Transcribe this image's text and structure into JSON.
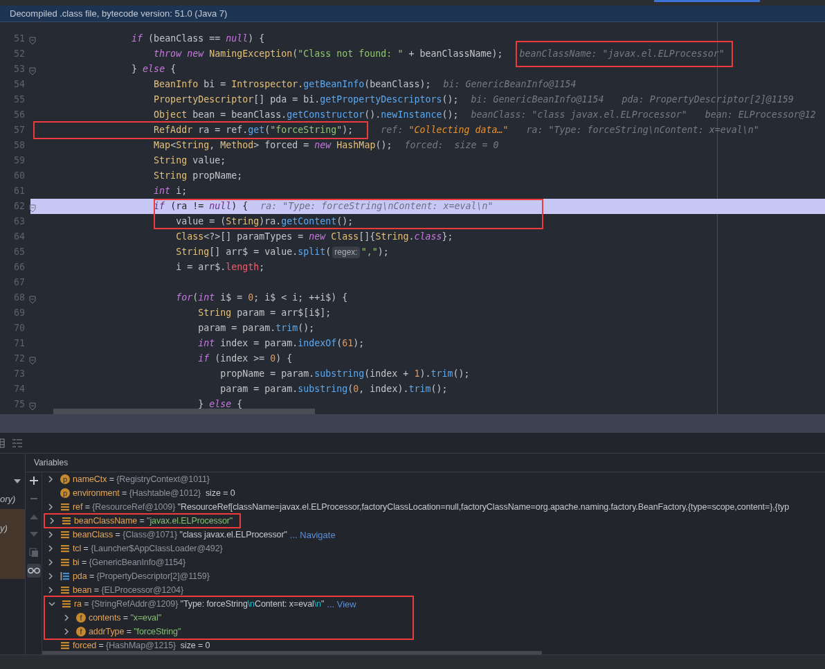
{
  "banner": "Decompiled .class file, bytecode version: 51.0 (Java 7)",
  "editor": {
    "lines": [
      {
        "number": "51",
        "fold": true,
        "current": false,
        "code": [
          {
            "text": "                if",
            "kind": "keyword"
          },
          {
            "text": " (beanClass == ",
            "kind": "plain"
          },
          {
            "text": "null",
            "kind": "keyword"
          },
          {
            "text": ") {",
            "kind": "plain"
          }
        ]
      },
      {
        "number": "52",
        "fold": false,
        "current": false,
        "box_hints": true,
        "code": [
          {
            "text": "                    throw",
            "kind": "keyword"
          },
          {
            "text": " new",
            "kind": "keyword"
          },
          {
            "text": " NamingException",
            "kind": "type"
          },
          {
            "text": "(",
            "kind": "plain"
          },
          {
            "text": "\"Class not found: \"",
            "kind": "string"
          },
          {
            "text": " + beanClassName);",
            "kind": "plain"
          }
        ],
        "hints": [
          {
            "label": "beanClassName:",
            "value": "\"javax.el.ELProcessor\"",
            "kind": "value"
          }
        ]
      },
      {
        "number": "53",
        "fold": true,
        "current": false,
        "code": [
          {
            "text": "                } ",
            "kind": "plain"
          },
          {
            "text": "else",
            "kind": "keyword"
          },
          {
            "text": " {",
            "kind": "plain"
          }
        ]
      },
      {
        "number": "54",
        "fold": false,
        "current": false,
        "code": [
          {
            "text": "                    BeanInfo",
            "kind": "type"
          },
          {
            "text": " bi = ",
            "kind": "plain"
          },
          {
            "text": "Introspector.",
            "kind": "type"
          },
          {
            "text": "getBeanInfo",
            "kind": "method"
          },
          {
            "text": "(beanClass);",
            "kind": "plain"
          }
        ],
        "hints": [
          {
            "label": "bi:",
            "value": "GenericBeanInfo@1154",
            "kind": "value"
          }
        ]
      },
      {
        "number": "55",
        "fold": false,
        "current": false,
        "code": [
          {
            "text": "                    PropertyDescriptor",
            "kind": "type"
          },
          {
            "text": "[] pda = bi.",
            "kind": "plain"
          },
          {
            "text": "getPropertyDescriptors",
            "kind": "method"
          },
          {
            "text": "();",
            "kind": "plain"
          }
        ],
        "hints": [
          {
            "label": "bi:",
            "value": "GenericBeanInfo@1154",
            "kind": "value"
          },
          {
            "label": "pda:",
            "value": "PropertyDescriptor[2]@1159",
            "kind": "value"
          }
        ]
      },
      {
        "number": "56",
        "fold": false,
        "current": false,
        "code": [
          {
            "text": "                    Object",
            "kind": "type"
          },
          {
            "text": " bean = beanClass.",
            "kind": "plain"
          },
          {
            "text": "getConstructor",
            "kind": "method"
          },
          {
            "text": "().",
            "kind": "plain"
          },
          {
            "text": "newInstance",
            "kind": "method"
          },
          {
            "text": "();",
            "kind": "plain"
          }
        ],
        "hints": [
          {
            "label": "beanClass:",
            "value": "\"class javax.el.ELProcessor\"",
            "kind": "value"
          },
          {
            "label": "bean:",
            "value": "ELProcessor@12",
            "kind": "value"
          }
        ]
      },
      {
        "number": "57",
        "fold": false,
        "current": false,
        "box_code": true,
        "code": [
          {
            "text": "                    RefAddr",
            "kind": "type"
          },
          {
            "text": " ra = ref.",
            "kind": "plain"
          },
          {
            "text": "get",
            "kind": "method"
          },
          {
            "text": "(",
            "kind": "plain"
          },
          {
            "text": "\"forceString\"",
            "kind": "string"
          },
          {
            "text": ");",
            "kind": "plain"
          }
        ],
        "hints": [
          {
            "label": "ref:",
            "value": "\"Collecting data…\"",
            "kind": "loading"
          },
          {
            "label": "ra:",
            "value": "\"Type: forceString\\nContent: x=eval\\n\"",
            "kind": "value"
          }
        ]
      },
      {
        "number": "58",
        "fold": false,
        "current": false,
        "code": [
          {
            "text": "                    Map",
            "kind": "type"
          },
          {
            "text": "<",
            "kind": "plain"
          },
          {
            "text": "String",
            "kind": "type"
          },
          {
            "text": ", ",
            "kind": "plain"
          },
          {
            "text": "Method",
            "kind": "type"
          },
          {
            "text": "> forced = ",
            "kind": "plain"
          },
          {
            "text": "new",
            "kind": "keyword"
          },
          {
            "text": " HashMap",
            "kind": "type"
          },
          {
            "text": "();",
            "kind": "plain"
          }
        ],
        "hints": [
          {
            "label": "forced:",
            "value": " size = 0",
            "kind": "value"
          }
        ]
      },
      {
        "number": "59",
        "fold": false,
        "current": false,
        "code": [
          {
            "text": "                    String",
            "kind": "type"
          },
          {
            "text": " value;",
            "kind": "plain"
          }
        ]
      },
      {
        "number": "60",
        "fold": false,
        "current": false,
        "code": [
          {
            "text": "                    String",
            "kind": "type"
          },
          {
            "text": " propName;",
            "kind": "plain"
          }
        ]
      },
      {
        "number": "61",
        "fold": false,
        "current": false,
        "code": [
          {
            "text": "                    int",
            "kind": "keyword"
          },
          {
            "text": " i;",
            "kind": "plain"
          }
        ]
      },
      {
        "number": "62",
        "fold": true,
        "current": true,
        "box_lines": true,
        "code": [
          {
            "text": "                    if",
            "kind": "keyword"
          },
          {
            "text": " (ra != ",
            "kind": "plain"
          },
          {
            "text": "null",
            "kind": "keyword"
          },
          {
            "text": ") {",
            "kind": "plain"
          }
        ],
        "hints": [
          {
            "label": "ra:",
            "value": "\"Type: forceString\\nContent: x=eval\\n\"",
            "kind": "value"
          }
        ]
      },
      {
        "number": "63",
        "fold": false,
        "current": false,
        "box_lines": true,
        "code": [
          {
            "text": "                        value = (",
            "kind": "plain"
          },
          {
            "text": "String",
            "kind": "type"
          },
          {
            "text": ")ra.",
            "kind": "plain"
          },
          {
            "text": "getContent",
            "kind": "method"
          },
          {
            "text": "();",
            "kind": "plain"
          }
        ]
      },
      {
        "number": "64",
        "fold": false,
        "current": false,
        "code": [
          {
            "text": "                        Class",
            "kind": "type"
          },
          {
            "text": "<?>[] paramTypes = ",
            "kind": "plain"
          },
          {
            "text": "new",
            "kind": "keyword"
          },
          {
            "text": " Class",
            "kind": "type"
          },
          {
            "text": "[]{",
            "kind": "plain"
          },
          {
            "text": "String",
            "kind": "type"
          },
          {
            "text": ".",
            "kind": "plain"
          },
          {
            "text": "class",
            "kind": "keyword"
          },
          {
            "text": "};",
            "kind": "plain"
          }
        ]
      },
      {
        "number": "65",
        "fold": false,
        "current": false,
        "code": [
          {
            "text": "                        String",
            "kind": "type"
          },
          {
            "text": "[] arr$ = value.",
            "kind": "plain"
          },
          {
            "text": "split",
            "kind": "method"
          },
          {
            "text": "(",
            "kind": "plain"
          },
          {
            "text": "regex:",
            "kind": "chip"
          },
          {
            "text": "\",\"",
            "kind": "string"
          },
          {
            "text": ");",
            "kind": "plain"
          }
        ]
      },
      {
        "number": "66",
        "fold": false,
        "current": false,
        "code": [
          {
            "text": "                        i = arr$.",
            "kind": "plain"
          },
          {
            "text": "length",
            "kind": "field"
          },
          {
            "text": ";",
            "kind": "plain"
          }
        ]
      },
      {
        "number": "67",
        "fold": false,
        "current": false
      },
      {
        "number": "68",
        "fold": true,
        "current": false,
        "code": [
          {
            "text": "                        for",
            "kind": "keyword"
          },
          {
            "text": "(",
            "kind": "plain"
          },
          {
            "text": "int",
            "kind": "keyword"
          },
          {
            "text": " i$ = ",
            "kind": "plain"
          },
          {
            "text": "0",
            "kind": "number"
          },
          {
            "text": "; i$ < i; ++i$) {",
            "kind": "plain"
          }
        ]
      },
      {
        "number": "69",
        "fold": false,
        "current": false,
        "code": [
          {
            "text": "                            String",
            "kind": "type"
          },
          {
            "text": " param = arr$[i$];",
            "kind": "plain"
          }
        ]
      },
      {
        "number": "70",
        "fold": false,
        "current": false,
        "code": [
          {
            "text": "                            param = param.",
            "kind": "plain"
          },
          {
            "text": "trim",
            "kind": "method"
          },
          {
            "text": "();",
            "kind": "plain"
          }
        ]
      },
      {
        "number": "71",
        "fold": false,
        "current": false,
        "code": [
          {
            "text": "                            int",
            "kind": "keyword"
          },
          {
            "text": " index = param.",
            "kind": "plain"
          },
          {
            "text": "indexOf",
            "kind": "method"
          },
          {
            "text": "(",
            "kind": "plain"
          },
          {
            "text": "61",
            "kind": "number"
          },
          {
            "text": ");",
            "kind": "plain"
          }
        ]
      },
      {
        "number": "72",
        "fold": true,
        "current": false,
        "code": [
          {
            "text": "                            if",
            "kind": "keyword"
          },
          {
            "text": " (index >= ",
            "kind": "plain"
          },
          {
            "text": "0",
            "kind": "number"
          },
          {
            "text": ") {",
            "kind": "plain"
          }
        ]
      },
      {
        "number": "73",
        "fold": false,
        "current": false,
        "code": [
          {
            "text": "                                propName = param.",
            "kind": "plain"
          },
          {
            "text": "substring",
            "kind": "method"
          },
          {
            "text": "(index + ",
            "kind": "plain"
          },
          {
            "text": "1",
            "kind": "number"
          },
          {
            "text": ").",
            "kind": "plain"
          },
          {
            "text": "trim",
            "kind": "method"
          },
          {
            "text": "();",
            "kind": "plain"
          }
        ]
      },
      {
        "number": "74",
        "fold": false,
        "current": false,
        "code": [
          {
            "text": "                                param = param.",
            "kind": "plain"
          },
          {
            "text": "substring",
            "kind": "method"
          },
          {
            "text": "(",
            "kind": "plain"
          },
          {
            "text": "0",
            "kind": "number"
          },
          {
            "text": ", index).",
            "kind": "plain"
          },
          {
            "text": "trim",
            "kind": "method"
          },
          {
            "text": "();",
            "kind": "plain"
          }
        ]
      },
      {
        "number": "75",
        "fold": true,
        "current": false,
        "code": [
          {
            "text": "                            } ",
            "kind": "plain"
          },
          {
            "text": "else",
            "kind": "keyword"
          },
          {
            "text": " {",
            "kind": "plain"
          }
        ]
      }
    ]
  },
  "debugger": {
    "frames": [
      {
        "text": "ory)",
        "selected": false
      },
      {
        "text": "y)",
        "selected": true
      }
    ],
    "variables_title": "Variables",
    "variables": [
      {
        "name": "nameCtx",
        "op": "=",
        "kind": "param",
        "badge": "p",
        "expandable": true,
        "expanded": false,
        "type": "{RegistryContext@1011}"
      },
      {
        "name": "environment",
        "op": "=",
        "kind": "param",
        "badge": "p",
        "expandable": false,
        "type": "{Hashtable@1012}",
        "extra": "size = 0"
      },
      {
        "name": "ref",
        "op": "=",
        "kind": "local",
        "expandable": true,
        "expanded": false,
        "type": "{ResourceRef@1009}",
        "value": [
          {
            "text": "\"ResourceRef[className=javax.el.ELProcessor,factoryClassLocation=null,factoryClassName=org.apache.naming.factory.BeanFactory,{type=scope,content=},{typ",
            "kind": "plain"
          }
        ]
      },
      {
        "name": "beanClassName",
        "op": "=",
        "kind": "local",
        "expandable": true,
        "expanded": false,
        "marked": true,
        "value": [
          {
            "text": "\"javax.el.ELProcessor\"",
            "kind": "string"
          }
        ]
      },
      {
        "name": "beanClass",
        "op": "=",
        "kind": "local",
        "expandable": true,
        "expanded": false,
        "type": "{Class@1071}",
        "value": [
          {
            "text": "\"class javax.el.ELProcessor\"",
            "kind": "plain"
          }
        ],
        "link": "... Navigate"
      },
      {
        "name": "tcl",
        "op": "=",
        "kind": "local",
        "expandable": true,
        "expanded": false,
        "type": "{Launcher$AppClassLoader@492}"
      },
      {
        "name": "bi",
        "op": "=",
        "kind": "local",
        "expandable": true,
        "expanded": false,
        "type": "{GenericBeanInfo@1154}"
      },
      {
        "name": "pda",
        "op": "=",
        "kind": "array",
        "expandable": true,
        "expanded": false,
        "type": "{PropertyDescriptor[2]@1159}"
      },
      {
        "name": "bean",
        "op": "=",
        "kind": "local",
        "expandable": true,
        "expanded": false,
        "type": "{ELProcessor@1204}"
      },
      {
        "name": "ra",
        "op": "=",
        "kind": "local",
        "expandable": true,
        "expanded": true,
        "marked": true,
        "type": "{StringRefAddr@1209}",
        "value": [
          {
            "text": "\"Type: forceString",
            "kind": "plain"
          },
          {
            "text": "\\n",
            "kind": "escape"
          },
          {
            "text": "Content: x=eval",
            "kind": "plain"
          },
          {
            "text": "\\n",
            "kind": "escape"
          },
          {
            "text": "\"",
            "kind": "plain"
          }
        ],
        "link": "... View",
        "children": [
          {
            "name": "contents",
            "op": "=",
            "kind": "field",
            "badge": "f",
            "expandable": true,
            "expanded": false,
            "value": [
              {
                "text": "\"x=eval\"",
                "kind": "string"
              }
            ]
          },
          {
            "name": "addrType",
            "op": "=",
            "kind": "field",
            "badge": "f",
            "expandable": true,
            "expanded": false,
            "value": [
              {
                "text": "\"forceString\"",
                "kind": "string"
              }
            ]
          }
        ]
      },
      {
        "name": "forced",
        "op": "=",
        "kind": "local",
        "expandable": false,
        "type": "{HashMap@1215}",
        "extra": "size = 0"
      }
    ]
  }
}
